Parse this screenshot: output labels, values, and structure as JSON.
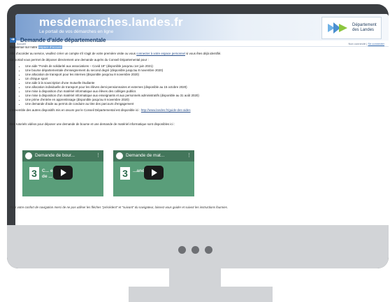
{
  "header": {
    "site_name": "mesdemarches.landes.fr",
    "tagline": "Le portail de vos démarches en ligne",
    "logo_text_line1": "Département",
    "logo_text_line2": "des Landes",
    "accent": "#7b9fd0"
  },
  "crumbbar": {
    "breadcrumb": "Accueil",
    "user_status": "Non connecté",
    "separator": "|",
    "login_link": "Se connecter"
  },
  "page": {
    "title": "Demande d'aide départementale",
    "welcome_prefix": "Bienvenue sur notre",
    "welcome_highlight": "espace d'accueil",
    "intro_prefix": "Afin d'accéder au service, veuillez créer un compte s'il s'agit de votre première visite ou vous",
    "intro_link": "connecter à votre espace personnel",
    "intro_suffix": "si vous êtes déjà identifié.",
    "portal_text": "Ce portail vous permet de déposer directement une demande auprès du Conseil Départemental pour :",
    "items": [
      "Une aide \"Fonds de solidarité aux associations – Covid 19\" (disponible jusqu'au 1er juin 2021)",
      "Une bourse départementale d'enseignement du second degré (disponible jusqu'au 8 novembre 2020)",
      "Une allocation de transport pour les internes (disponible jusqu'au 8 novembre 2020)",
      "Un chèque sport",
      "Une aide à la souscription d'une mutuelle étudiante",
      "Une allocation individuelle de transport pour les élèves demi-pensionnaires et externes (disponible au 15 octobre 2020)",
      "Une mise à disposition d'un matériel informatique aux élèves des collèges publics",
      "Une mise à disposition d'un matériel informatique aux enseignants et aux personnels administratifs (disponible au 31 août 2020)",
      "Une prime d'entrée en apprentissage (disponible jusqu'au 8 novembre 2020)",
      "Une demande d'aide au permis de conduire au titre des parcours d'engagement"
    ],
    "other_prefix": "L'ensemble des autres dispositifs mis en œuvre par le Conseil Départemental est disponible ici :",
    "other_link": "http://www.landes.fr/guide-des-aides",
    "tutorials_text": "Des tutoriels vidéos pour déposer une demande de bourse et une demande de matériel informatique sont disponibles ici :",
    "footer_note": "Pour votre confort de navigation merci de ne pas utiliser les flèches \"précédent\" et \"suivant\" du navigateur, laissez-vous guider et suivez les instructions fournies."
  },
  "videos": [
    {
      "title": "Demande de bour...",
      "number": "3",
      "subtitle_line1": "C... emande",
      "subtitle_line2": "de ... en ligne",
      "menu": "⋮"
    },
    {
      "title": "Demande de mat...",
      "number": "3",
      "subtitle_line1": "",
      "subtitle_line2": "...ande",
      "menu": "⋮"
    }
  ]
}
